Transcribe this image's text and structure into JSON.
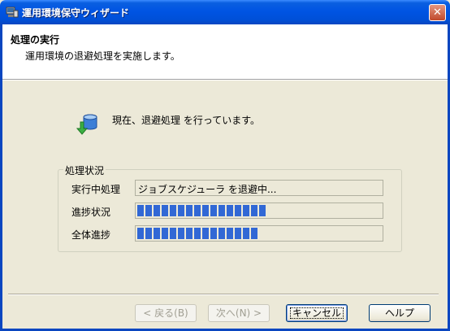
{
  "window": {
    "title": "運用環境保守ウィザード",
    "close_label": "✕"
  },
  "header": {
    "title": "処理の実行",
    "subtitle": "運用環境の退避処理を実施します。"
  },
  "status": {
    "icon": "database-backup-icon",
    "message": "現在、退避処理 を行っています。"
  },
  "progress_group": {
    "legend": "処理状況",
    "current_label": "実行中処理",
    "current_value": "ジョブスケジューラ を退避中...",
    "step_label": "進捗状況",
    "step_progress": 0.55,
    "overall_label": "全体進捗",
    "overall_progress": 0.51,
    "bar_color": "#3168d5"
  },
  "buttons": {
    "back": "< 戻る(B)",
    "next": "次へ(N) >",
    "cancel": "キャンセル",
    "help": "ヘルプ"
  }
}
